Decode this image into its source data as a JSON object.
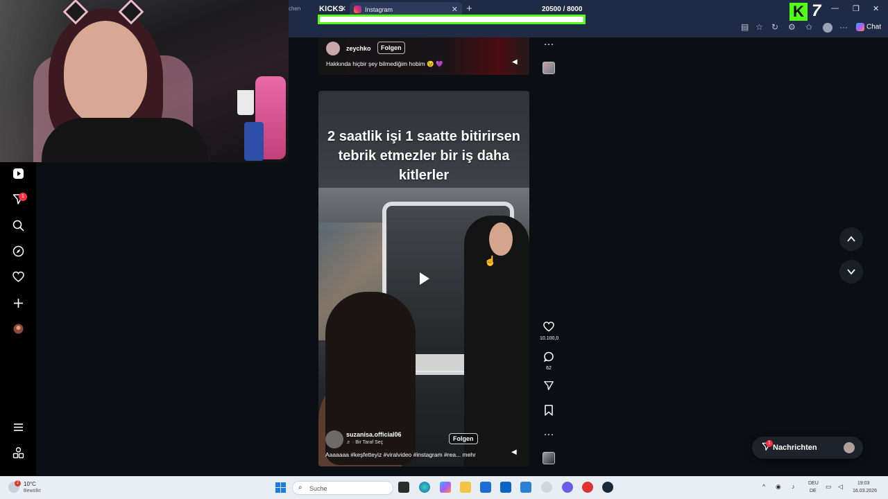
{
  "browser": {
    "tab_fragment": "chen",
    "kicks_label": "KICKS",
    "kicks_close": "✕",
    "active_tab_label": "Instagram",
    "active_tab_close": "✕",
    "new_tab": "+",
    "counter_text": "20500  / 8000",
    "progress_fraction": 1.0,
    "seven": "7",
    "k_logo": "K",
    "chat_label": "Chat",
    "win_min": "—",
    "win_restore": "❐",
    "win_close": "✕"
  },
  "leftnav": {
    "badge": "1"
  },
  "top_post": {
    "username": "zeychko",
    "follow_label": "Folgen",
    "description": "Hakkında hiçbir şey bilmediğim hobim 😉 💜",
    "more": "···"
  },
  "reel": {
    "caption": "2 saatlik işi 1 saatte bitirirsen tebrik etmezler bir iş daha kitlerler",
    "username": "suzanisa.official06",
    "song": "♬ · Bir Taraf Seç",
    "follow_label": "Folgen",
    "description": "Aaaaaaa #keşfetteyiz #viralvideo #instagram #rea... mehr",
    "likes": "10.100,0",
    "comments": "62",
    "more": "···"
  },
  "messages": {
    "label": "Nachrichten",
    "badge": "1"
  },
  "taskbar": {
    "weather_temp": "10°C",
    "weather_desc": "Bewölkt",
    "weather_badge": "2",
    "search_placeholder": "Suche",
    "lang_1": "DEU",
    "lang_2": "DE",
    "time": "19:03",
    "date": "16.03.2026"
  },
  "colors": {
    "kick_green": "#53fc18",
    "background": "#0b0f14",
    "notification_red": "#ff3040"
  }
}
